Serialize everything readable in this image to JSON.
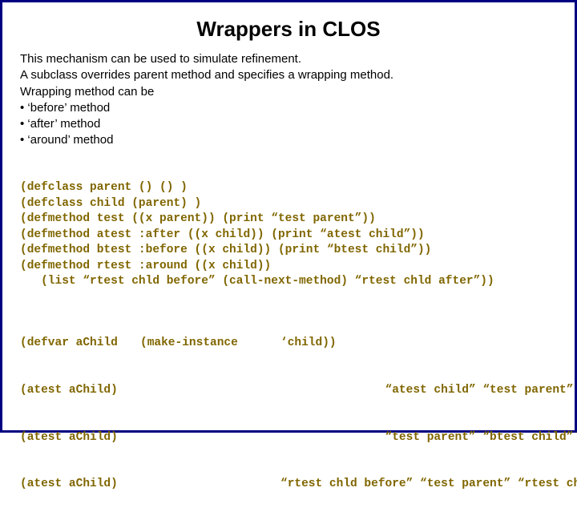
{
  "title": "Wrappers in CLOS",
  "intro": {
    "l1": "This mechanism can be used to simulate refinement.",
    "l2": "A subclass overrides parent method and specifies a wrapping method.",
    "l3": "Wrapping method can be",
    "b1": "• ‘before’ method",
    "b2": "• ‘after’ method",
    "b3": "• ‘around’ method"
  },
  "code1": {
    "l1": "(defclass parent () () )",
    "l2": "(defclass child (parent) )",
    "l3": "(defmethod test ((x parent)) (print “test parent”))",
    "l4": "(defmethod atest :after ((x child)) (print “atest child”))",
    "l5": "(defmethod btest :before ((x child)) (print “btest child”))",
    "l6": "(defmethod rtest :around ((x child))",
    "l7": "   (list “rtest chld before” (call-next-method) “rtest chld after”))"
  },
  "code2": {
    "r0": {
      "left": "(defvar aChild",
      "mid": "(make-instance",
      "right": "‘child))"
    },
    "r1": {
      "left": "(atest aChild)",
      "mid": "",
      "right": "               “atest child” “test parent”"
    },
    "r2": {
      "left": "(atest aChild)",
      "mid": "",
      "right": "               “test parent” “btest child”"
    },
    "r3": {
      "left": "(atest aChild)",
      "mid": "",
      "right": "“rtest chld before” “test parent” “rtest chld after”"
    }
  }
}
